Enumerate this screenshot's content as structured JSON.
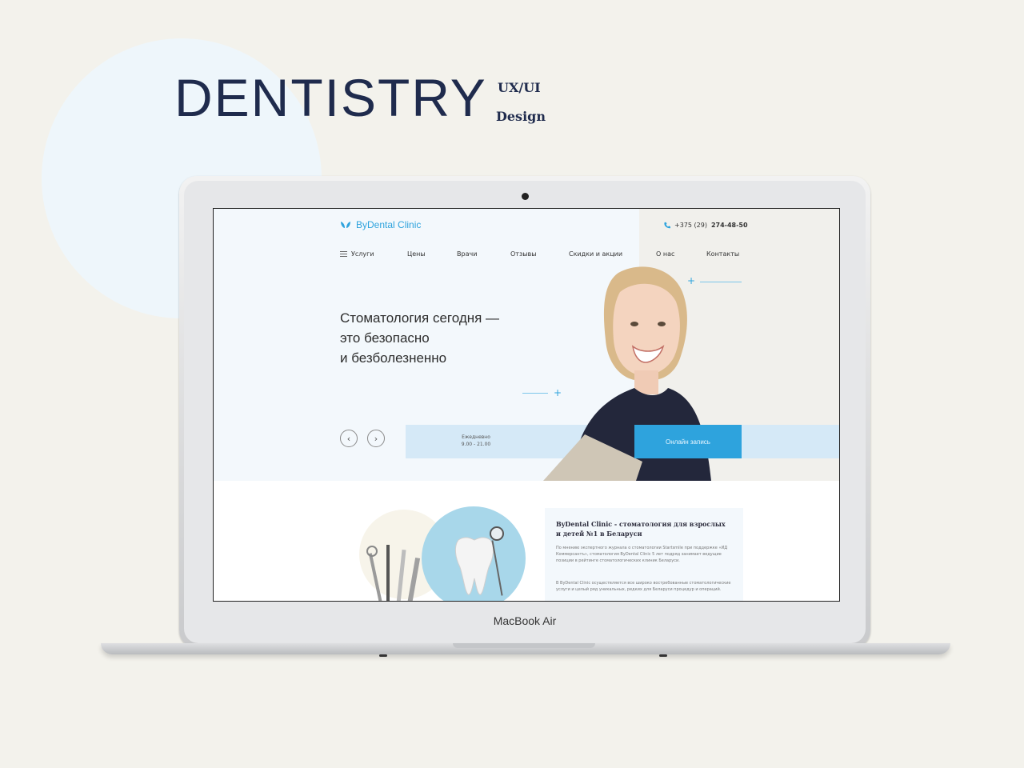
{
  "showcase": {
    "title": "DENTISTRY",
    "tag_line1": "UX/UI",
    "tag_line2": "Design",
    "device_label": "MacBook Air"
  },
  "site": {
    "brand": "ByDental Clinic",
    "phone_prefix": "+375 (29)",
    "phone_number": "274-48-50",
    "nav": [
      "Услуги",
      "Цены",
      "Врачи",
      "Отзывы",
      "Скидки и акции",
      "О нас",
      "Контакты"
    ],
    "hero": {
      "line1": "Стоматология сегодня —",
      "line2": "это безопасно",
      "line3": "и безболезненно"
    },
    "hours_label": "Ежедневно",
    "hours_value": "9.00 - 21.00",
    "cta": "Онлайн запись",
    "info": {
      "title": "ByDental Clinic - стоматология для взрослых и детей №1 в Беларуси",
      "paragraph1": "По мнению экспертного журнала о стоматологии Startsmile при поддержке «ИД Коммерсантъ», стоматология ByDental Clinic 5 лет подряд занимает ведущие позиции в рейтинге стоматологических клиник Беларуси.",
      "paragraph2": "В ByDental Clinic осуществляется все широко востребованные стоматологические услуги и целый ряд уникальных, редких для Беларуси процедур и операций."
    }
  },
  "colors": {
    "background": "#f3f2ec",
    "accent": "#2ea3dd",
    "title": "#1f2b4d",
    "hero_bg": "#f3f8fc",
    "hours_bar": "#d5e9f7"
  }
}
